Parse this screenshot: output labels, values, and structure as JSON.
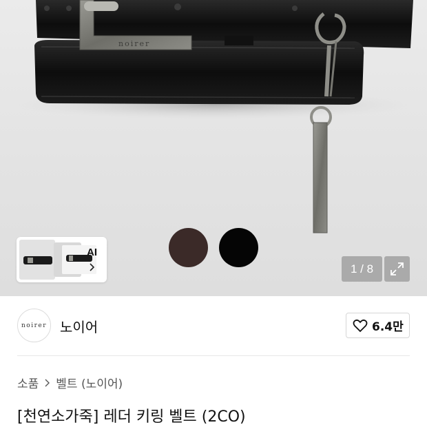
{
  "gallery": {
    "ai_label": "AI",
    "counter": "1 / 8",
    "engraving": "noirer"
  },
  "colors": {
    "swatches": [
      "#3b2a28",
      "#050505"
    ]
  },
  "brand": {
    "logo_text": "noirer",
    "name": "노이어",
    "likes": "6.4만"
  },
  "breadcrumb": {
    "category": "소품",
    "subcategory": "벨트 (노이어)"
  },
  "product": {
    "title": "[천연소가죽] 레더 키링 벨트 (2CO)"
  },
  "icons": [
    "chevron-right-icon",
    "expand-icon",
    "heart-icon"
  ]
}
